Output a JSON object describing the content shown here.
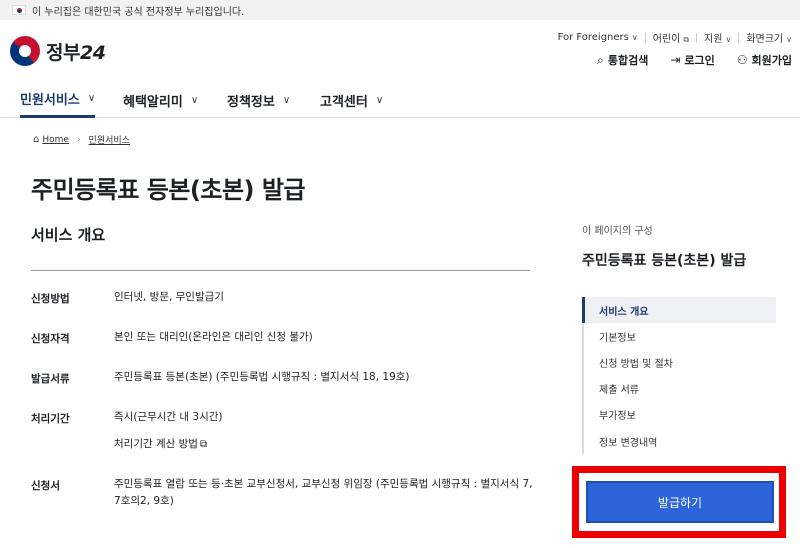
{
  "gov_banner": {
    "flag_icon": "korean-flag-icon",
    "text": "이 누리집은 대한민국 공식 전자정부 누리집입니다."
  },
  "logo": {
    "text": "정부",
    "number": "24"
  },
  "utility": {
    "top": [
      {
        "label": "For Foreigners",
        "icon": "chevron-down-icon",
        "chevron": "∨"
      },
      {
        "label": "어린이",
        "icon": "external-link-icon",
        "chevron": "⧉"
      },
      {
        "label": "지원",
        "icon": "chevron-down-icon",
        "chevron": "∨"
      },
      {
        "label": "화면크기",
        "icon": "chevron-down-icon",
        "chevron": "∨"
      }
    ],
    "bottom": [
      {
        "label": "통합검색",
        "icon": "search-icon",
        "glyph": "⌕"
      },
      {
        "label": "로그인",
        "icon": "login-icon",
        "glyph": "⇥"
      },
      {
        "label": "회원가입",
        "icon": "user-plus-icon",
        "glyph": "⚇"
      }
    ]
  },
  "nav": [
    {
      "label": "민원서비스",
      "active": true
    },
    {
      "label": "혜택알리미",
      "active": false
    },
    {
      "label": "정책정보",
      "active": false
    },
    {
      "label": "고객센터",
      "active": false
    }
  ],
  "breadcrumb": {
    "home": "Home",
    "current": "민원서비스"
  },
  "page_title": "주민등록표 등본(초본) 발급",
  "section_title": "서비스 개요",
  "details": [
    {
      "label": "신청방법",
      "value": "인터넷, 방문, 무인발급기"
    },
    {
      "label": "신청자격",
      "value": "본인 또는 대리인(온라인은 대리인 신청 불가)"
    },
    {
      "label": "발급서류",
      "value": "주민등록표 등본(초본) (주민등록법 시행규칙 : 별지서식 18, 19호)"
    },
    {
      "label": "처리기간",
      "value": "즉시(근무시간 내 3시간)",
      "link": "처리기간 계산 방법",
      "link_icon": "⧉"
    },
    {
      "label": "신청서",
      "value": "주민등록표 열람 또는 등·초본 교부신청서, 교부신청 위임장 (주민등록법 시행규칙 : 별지서식 7, 7호의2, 9호)"
    }
  ],
  "toc": {
    "caption": "이 페이지의 구성",
    "title": "주민등록표 등본(초본) 발급",
    "items": [
      "서비스 개요",
      "기본정보",
      "신청 방법 및 절차",
      "제출 서류",
      "부가정보",
      "정보 변경내역"
    ],
    "active_index": 0
  },
  "apply_button": {
    "label": "발급하기"
  },
  "colors": {
    "accent": "#1e3b6e",
    "button": "#2b65d9",
    "highlight": "#ee0000"
  }
}
